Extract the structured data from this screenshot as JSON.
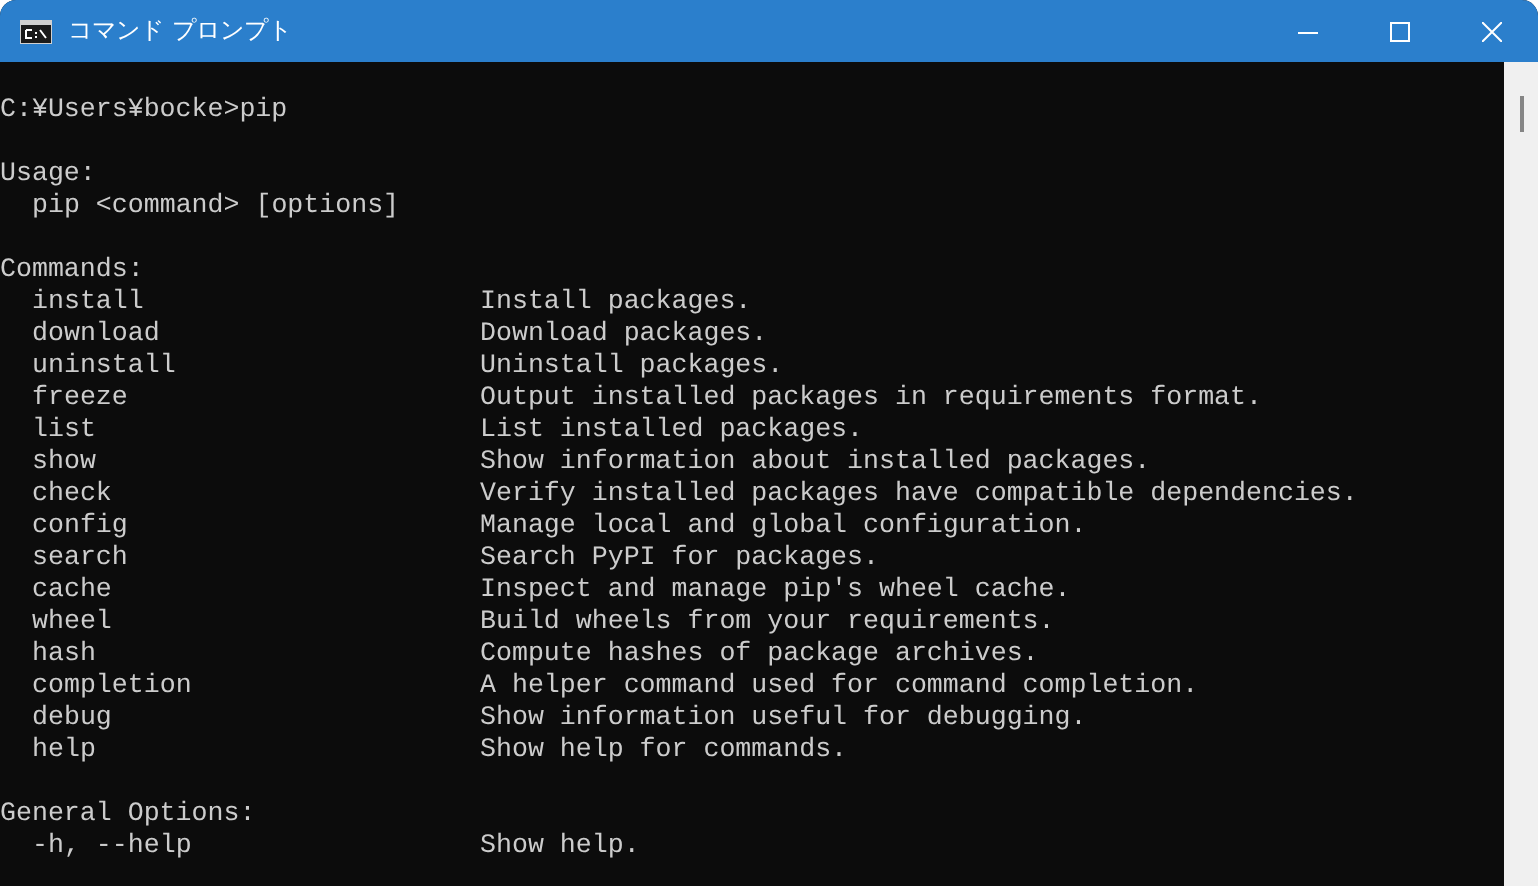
{
  "window": {
    "title": "コマンド プロンプト"
  },
  "console": {
    "prompt": "C:¥Users¥bocke>pip",
    "usage_heading": "Usage:",
    "usage": "pip <command> [options]",
    "commands_heading": "Commands:",
    "commands": [
      {
        "name": "install",
        "description": "Install packages."
      },
      {
        "name": "download",
        "description": "Download packages."
      },
      {
        "name": "uninstall",
        "description": "Uninstall packages."
      },
      {
        "name": "freeze",
        "description": "Output installed packages in requirements format."
      },
      {
        "name": "list",
        "description": "List installed packages."
      },
      {
        "name": "show",
        "description": "Show information about installed packages."
      },
      {
        "name": "check",
        "description": "Verify installed packages have compatible dependencies."
      },
      {
        "name": "config",
        "description": "Manage local and global configuration."
      },
      {
        "name": "search",
        "description": "Search PyPI for packages."
      },
      {
        "name": "cache",
        "description": "Inspect and manage pip's wheel cache."
      },
      {
        "name": "wheel",
        "description": "Build wheels from your requirements."
      },
      {
        "name": "hash",
        "description": "Compute hashes of package archives."
      },
      {
        "name": "completion",
        "description": "A helper command used for command completion."
      },
      {
        "name": "debug",
        "description": "Show information useful for debugging."
      },
      {
        "name": "help",
        "description": "Show help for commands."
      }
    ],
    "options_heading": "General Options:",
    "options": [
      {
        "name": "-h, --help",
        "description": "Show help."
      }
    ]
  }
}
